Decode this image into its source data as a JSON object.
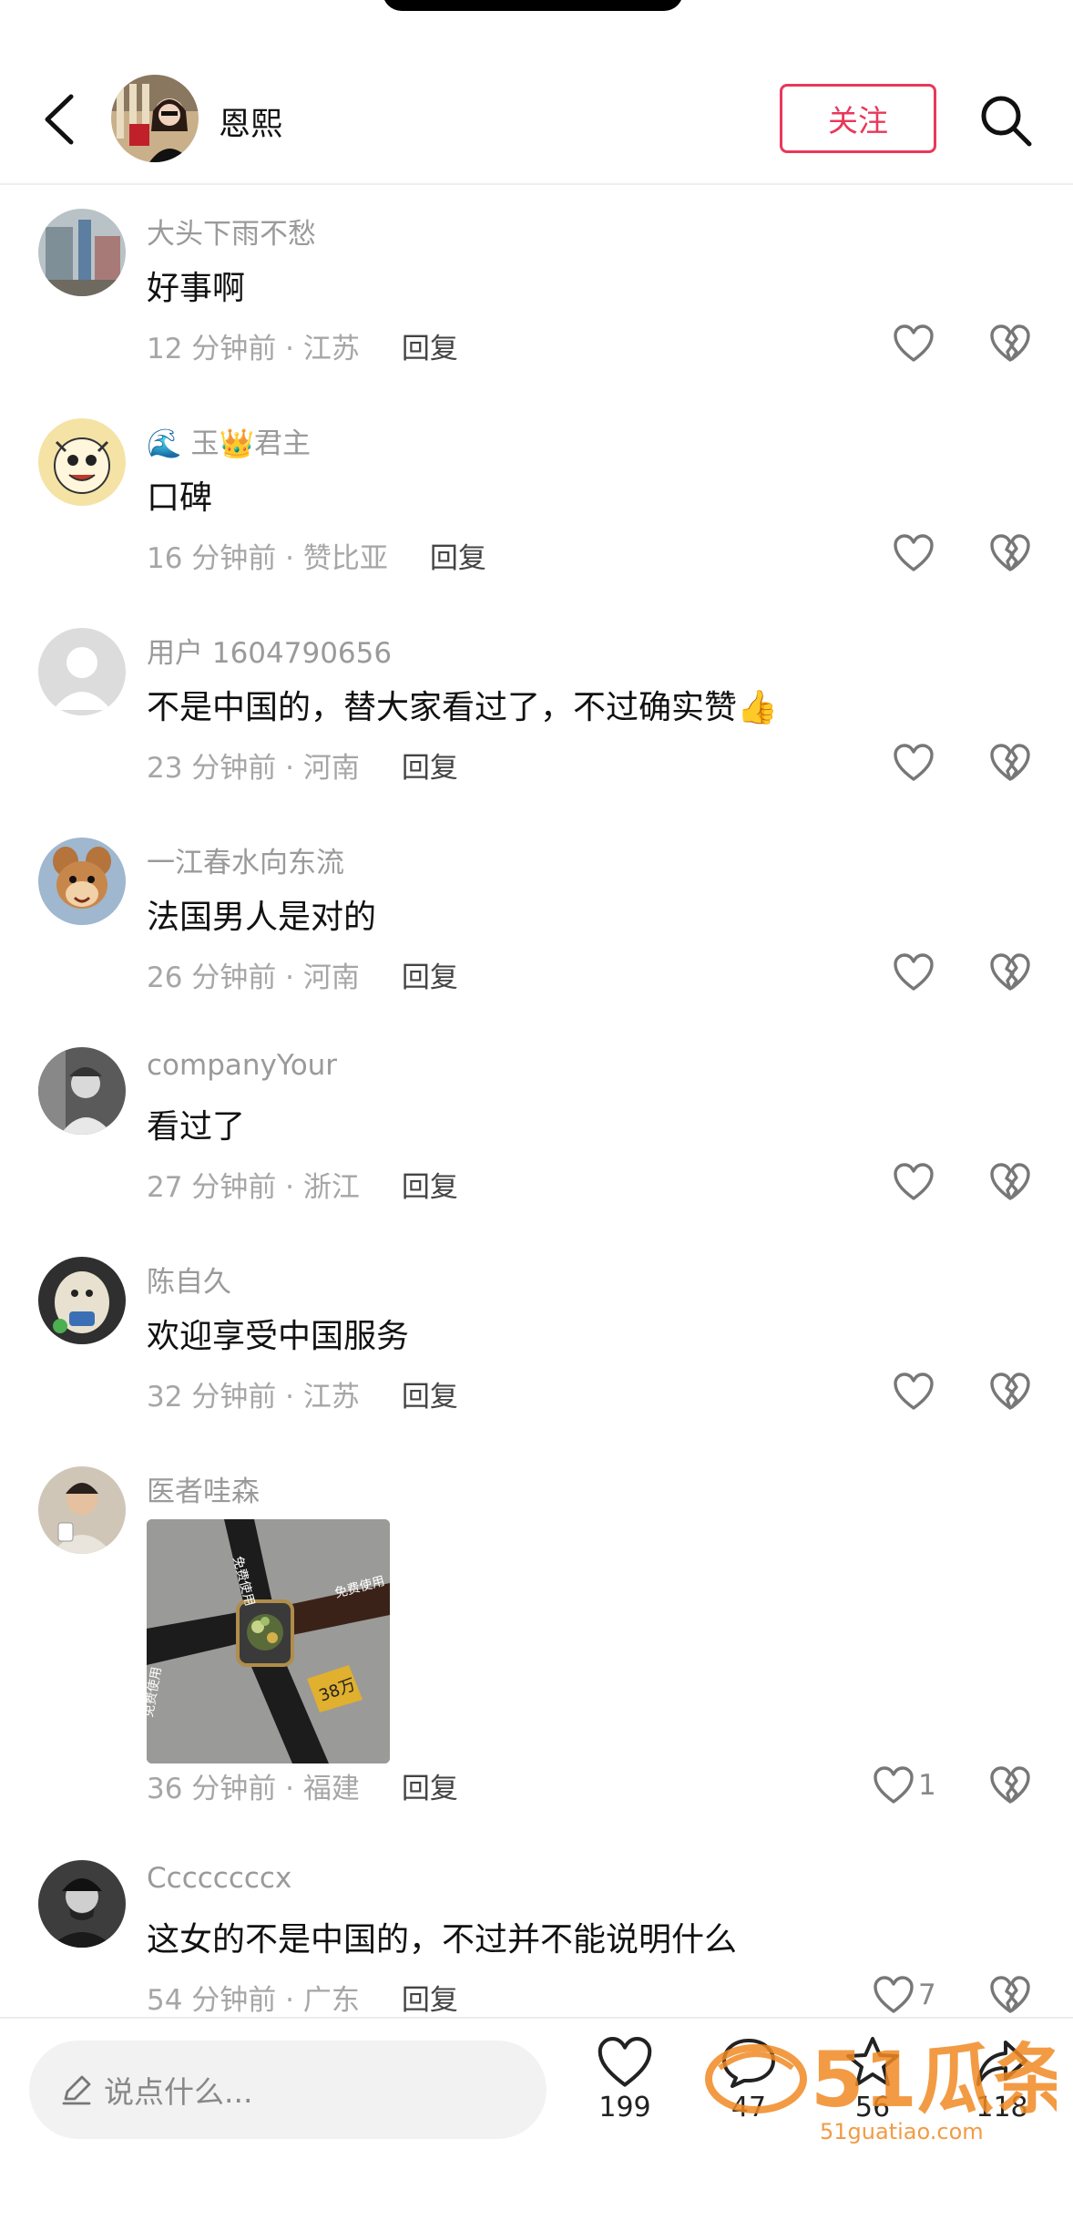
{
  "header": {
    "title": "恩熙",
    "follow_label": "关注"
  },
  "comments": [
    {
      "user": "大头下雨不愁",
      "text": "好事啊",
      "time": "12 分钟前",
      "location": "江苏",
      "reply": "回复",
      "likes": ""
    },
    {
      "user": "🌊 玉👑君主",
      "text": "口碑",
      "time": "16 分钟前",
      "location": "赞比亚",
      "reply": "回复",
      "likes": ""
    },
    {
      "user": "用户 1604790656",
      "text": "不是中国的，替大家看过了，不过确实赞👍",
      "time": "23 分钟前",
      "location": "河南",
      "reply": "回复",
      "likes": ""
    },
    {
      "user": "一江春水向东流",
      "text": "法国男人是对的",
      "time": "26 分钟前",
      "location": "河南",
      "reply": "回复",
      "likes": ""
    },
    {
      "user": "companyYour",
      "text": "看过了",
      "time": "27 分钟前",
      "location": "浙江",
      "reply": "回复",
      "likes": ""
    },
    {
      "user": "陈自久",
      "text": "欢迎享受中国服务",
      "time": "32 分钟前",
      "location": "江苏",
      "reply": "回复",
      "likes": ""
    },
    {
      "user": "医者哇森",
      "image_labels": [
        "免费使用",
        "免费使用",
        "免费使用",
        "38万"
      ],
      "time": "36 分钟前",
      "location": "福建",
      "reply": "回复",
      "likes": "1"
    },
    {
      "user": "Ccccccccx",
      "text": "这女的不是中国的，不过并不能说明什么",
      "time": "54 分钟前",
      "location": "广东",
      "reply": "回复",
      "likes": "7"
    }
  ],
  "bottom": {
    "input_placeholder": "说点什么...",
    "likes": "199",
    "comments": "47",
    "favorites": "56",
    "shares": "118"
  },
  "watermark": {
    "text": "51瓜条",
    "url": "51guatiao.com"
  },
  "colors": {
    "accent": "#e8385a",
    "watermark": "#f08a24"
  }
}
